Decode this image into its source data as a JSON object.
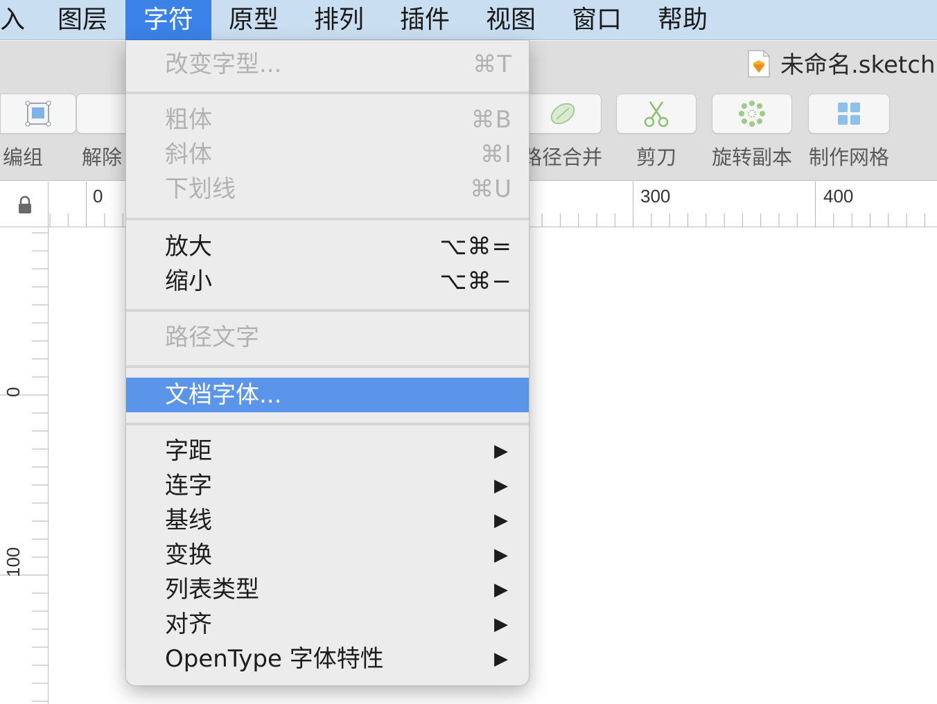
{
  "menubar": {
    "items": [
      "入",
      "图层",
      "字符",
      "原型",
      "排列",
      "插件",
      "视图",
      "窗口",
      "帮助"
    ],
    "active": "字符"
  },
  "window": {
    "title": "未命名.sketch"
  },
  "toolbar": {
    "labels": [
      "编组",
      "解除",
      "路径合并",
      "剪刀",
      "旋转副本",
      "制作网格"
    ]
  },
  "ruler": {
    "top_labels": [
      "0",
      "300",
      "400"
    ],
    "left_labels": [
      "0",
      "100"
    ]
  },
  "menu": {
    "change_font": {
      "label": "改变字型...",
      "shortcut": "⌘T"
    },
    "bold": {
      "label": "粗体",
      "shortcut": "⌘B"
    },
    "italic": {
      "label": "斜体",
      "shortcut": "⌘I"
    },
    "underline": {
      "label": "下划线",
      "shortcut": "⌘U"
    },
    "zoom_in": {
      "label": "放大",
      "shortcut": "⌥⌘="
    },
    "zoom_out": {
      "label": "缩小",
      "shortcut": "⌥⌘−"
    },
    "text_on_path": {
      "label": "路径文字"
    },
    "document_fonts": {
      "label": "文档字体..."
    },
    "kerning": {
      "label": "字距",
      "arrow": "▶"
    },
    "ligatures": {
      "label": "连字",
      "arrow": "▶"
    },
    "baseline": {
      "label": "基线",
      "arrow": "▶"
    },
    "transform": {
      "label": "变换",
      "arrow": "▶"
    },
    "list_type": {
      "label": "列表类型",
      "arrow": "▶"
    },
    "alignment": {
      "label": "对齐",
      "arrow": "▶"
    },
    "opentype": {
      "label": "OpenType 字体特性",
      "arrow": "▶"
    }
  },
  "colors": {
    "menubar_bg": "#c9def1",
    "menubar_active": "#3a82e8",
    "highlight": "#5b95ea",
    "disabled_text": "#b2b2b2"
  }
}
